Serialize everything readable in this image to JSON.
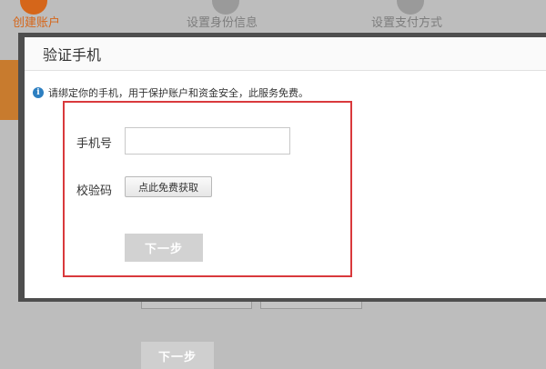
{
  "steps": [
    {
      "label": "创建账户",
      "active": true
    },
    {
      "label": "设置身份信息",
      "active": false
    },
    {
      "label": "设置支付方式",
      "active": false
    }
  ],
  "background": {
    "next_label": "下一步"
  },
  "modal": {
    "title": "验证手机",
    "notice": "请绑定你的手机，用于保护账户和资金安全，此服务免费。",
    "phone_label": "手机号",
    "phone_value": "",
    "code_label": "校验码",
    "code_button": "点此免费获取",
    "next_label": "下一步"
  },
  "colors": {
    "accent": "#d5661a",
    "highlight": "#d9393c",
    "info": "#2d7fc1"
  },
  "icons": {
    "notice": "info-icon"
  }
}
